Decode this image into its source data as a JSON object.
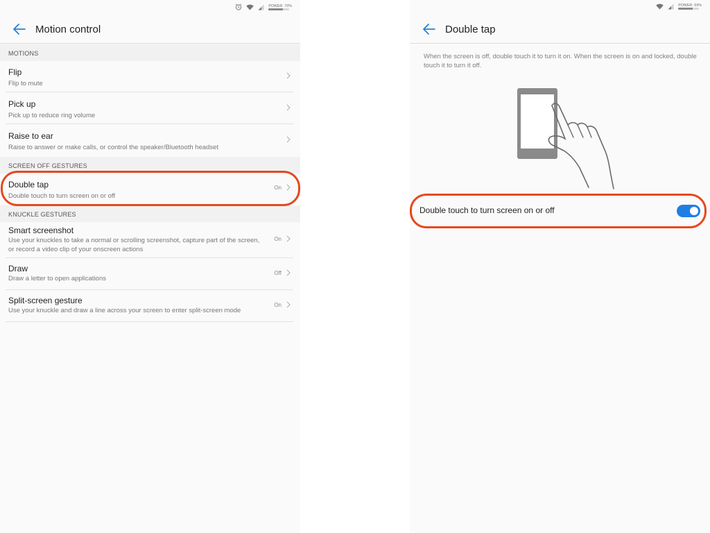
{
  "left": {
    "status": {
      "battery_text": "POWER: 70%",
      "battery_percent": 0.7
    },
    "app_bar": {
      "title": "Motion control"
    },
    "sections": {
      "motions": {
        "header": "MOTIONS",
        "items": [
          {
            "title": "Flip",
            "subtitle": "Flip to mute"
          },
          {
            "title": "Pick up",
            "subtitle": "Pick up to reduce ring volume"
          },
          {
            "title": "Raise to ear",
            "subtitle": "Raise to answer or make calls, or control the speaker/Bluetooth headset"
          }
        ]
      },
      "screen_off": {
        "header": "SCREEN OFF GESTURES",
        "items": [
          {
            "title": "Double tap",
            "subtitle": "Double touch to turn screen on or off",
            "value": "On"
          }
        ]
      },
      "knuckle": {
        "header": "KNUCKLE GESTURES",
        "items": [
          {
            "title": "Smart screenshot",
            "subtitle": "Use your knuckles to take a normal or scrolling screenshot, capture part of the screen, or record a video clip of your onscreen actions",
            "value": "On"
          },
          {
            "title": "Draw",
            "subtitle": "Draw a letter to open applications",
            "value": "Off"
          },
          {
            "title": "Split-screen gesture",
            "subtitle": "Use your knuckle and draw a line across your screen to enter split-screen mode",
            "value": "On"
          }
        ]
      }
    }
  },
  "right": {
    "status": {
      "battery_text": "POWER: 69%",
      "battery_percent": 0.69
    },
    "app_bar": {
      "title": "Double tap"
    },
    "description": "When the screen is off, double touch it to turn it on. When the screen is on and locked, double touch it to turn it off.",
    "toggle": {
      "label": "Double touch to turn screen on or off",
      "state": "on"
    }
  },
  "colors": {
    "accent": "#1f7ee6",
    "highlight": "#e6491f",
    "background": "#fafafa",
    "section_header_bg": "#f1f1f1"
  },
  "icons": [
    "back-arrow-icon",
    "alarm-icon",
    "wifi-icon",
    "signal-icon",
    "battery-icon",
    "chevron-right-icon"
  ]
}
